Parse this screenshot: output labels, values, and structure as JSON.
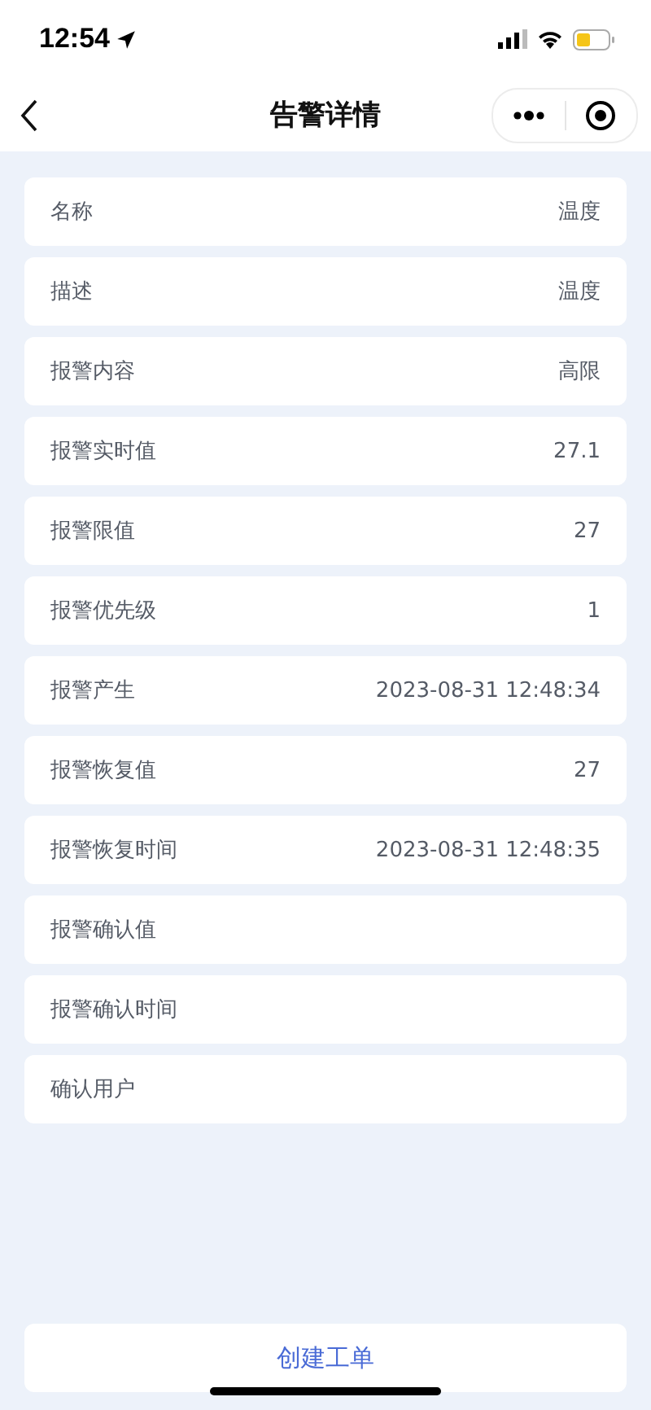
{
  "status_bar": {
    "time": "12:54"
  },
  "nav": {
    "title": "告警详情"
  },
  "fields": [
    {
      "label": "名称",
      "value": "温度"
    },
    {
      "label": "描述",
      "value": "温度"
    },
    {
      "label": "报警内容",
      "value": "高限"
    },
    {
      "label": "报警实时值",
      "value": "27.1"
    },
    {
      "label": "报警限值",
      "value": "27"
    },
    {
      "label": "报警优先级",
      "value": "1"
    },
    {
      "label": "报警产生",
      "value": "2023-08-31 12:48:34"
    },
    {
      "label": "报警恢复值",
      "value": "27"
    },
    {
      "label": "报警恢复时间",
      "value": "2023-08-31 12:48:35"
    },
    {
      "label": "报警确认值"
    },
    {
      "label": "报警确认时间"
    },
    {
      "label": "确认用户"
    }
  ],
  "action_button": "创建工单"
}
